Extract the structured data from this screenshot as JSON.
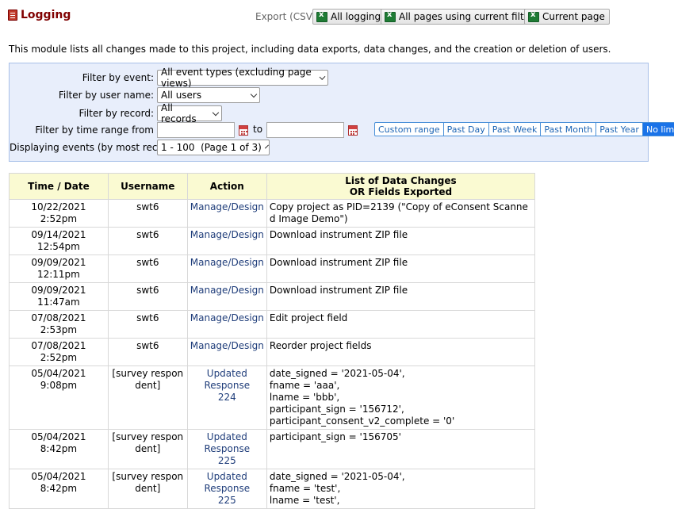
{
  "header": {
    "title": "Logging",
    "export_label": "Export (CSV):",
    "export_buttons": [
      "All logging",
      "All pages using current filters",
      "Current page"
    ]
  },
  "intro_text": "This module lists all changes made to this project, including data exports, data changes, and the creation or deletion of users.",
  "filters": {
    "event_label": "Filter by event:",
    "event_value": "All event types (excluding page views)",
    "user_label": "Filter by user name:",
    "user_value": "All users",
    "record_label": "Filter by record:",
    "record_value": "All records",
    "time_label": "Filter by time range from",
    "time_to": "to",
    "paging_label": "Displaying events (by most recent):",
    "paging_value": "1 - 100  (Page 1 of 3)",
    "ranges": [
      "Custom range",
      "Past Day",
      "Past Week",
      "Past Month",
      "Past Year",
      "No limit"
    ],
    "active_range": "No limit"
  },
  "table": {
    "headers": [
      "Time / Date",
      "Username",
      "Action",
      "List of Data Changes",
      "OR Fields Exported"
    ],
    "rows": [
      {
        "time": "10/22/2021 2:52pm",
        "user": "swt6",
        "action": [
          "Manage/Design"
        ],
        "changes": [
          "Copy project as PID=2139 (\"Copy of eConsent Scanned Image Demo\")"
        ]
      },
      {
        "time": "09/14/2021 12:54pm",
        "user": "swt6",
        "action": [
          "Manage/Design"
        ],
        "changes": [
          "Download instrument ZIP file"
        ]
      },
      {
        "time": "09/09/2021 12:11pm",
        "user": "swt6",
        "action": [
          "Manage/Design"
        ],
        "changes": [
          "Download instrument ZIP file"
        ]
      },
      {
        "time": "09/09/2021 11:47am",
        "user": "swt6",
        "action": [
          "Manage/Design"
        ],
        "changes": [
          "Download instrument ZIP file"
        ]
      },
      {
        "time": "07/08/2021 2:53pm",
        "user": "swt6",
        "action": [
          "Manage/Design"
        ],
        "changes": [
          "Edit project field"
        ]
      },
      {
        "time": "07/08/2021 2:52pm",
        "user": "swt6",
        "action": [
          "Manage/Design"
        ],
        "changes": [
          "Reorder project fields"
        ]
      },
      {
        "time": "05/04/2021 9:08pm",
        "user": "[survey respondent]",
        "action": [
          "Updated",
          "Response",
          "224"
        ],
        "changes": [
          "date_signed = '2021-05-04',",
          "fname = 'aaa',",
          "lname = 'bbb',",
          "participant_sign = '156712',",
          "participant_consent_v2_complete = '0'"
        ]
      },
      {
        "time": "05/04/2021 8:42pm",
        "user": "[survey respondent]",
        "action": [
          "Updated",
          "Response",
          "225"
        ],
        "changes": [
          "participant_sign = '156705'"
        ]
      },
      {
        "time": "05/04/2021 8:42pm",
        "user": "[survey respondent]",
        "action": [
          "Updated",
          "Response",
          "225"
        ],
        "changes": [
          "date_signed = '2021-05-04',",
          "fname = 'test',",
          "lname = 'test',"
        ]
      }
    ]
  }
}
